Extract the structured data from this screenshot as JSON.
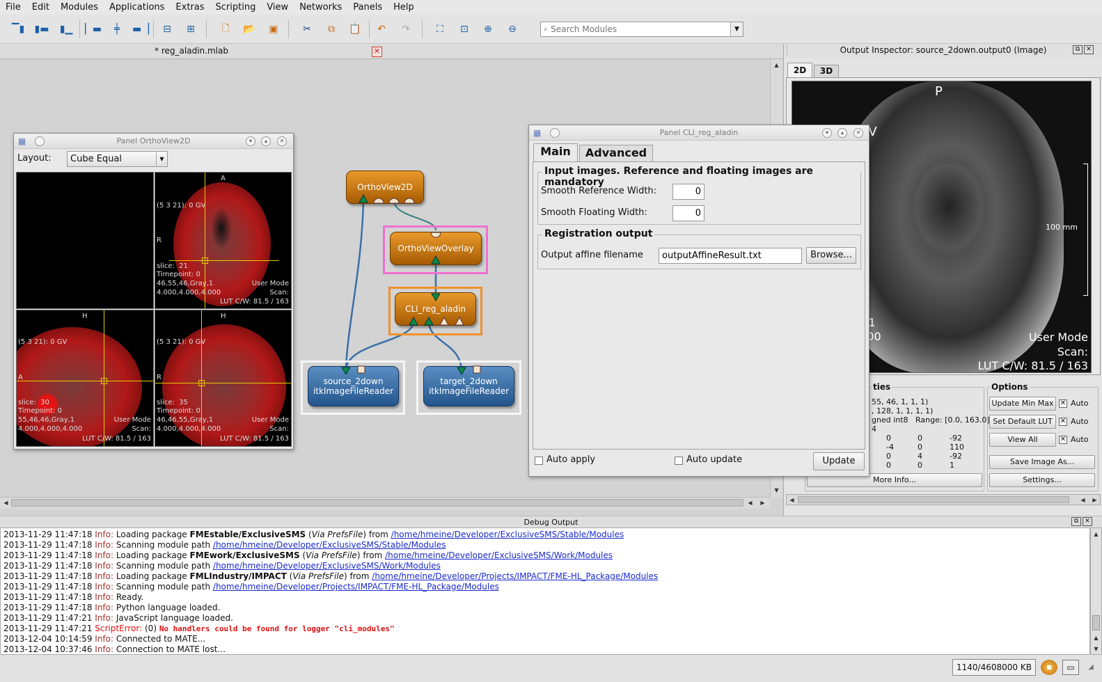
{
  "menu": [
    "File",
    "Edit",
    "Modules",
    "Applications",
    "Extras",
    "Scripting",
    "View",
    "Networks",
    "Panels",
    "Help"
  ],
  "search": {
    "placeholder": "Search Modules"
  },
  "network_tab": {
    "title": "* reg_aladin.mlab"
  },
  "modules": {
    "orthoview2d": "OrthoView2D",
    "overlay": "OrthoViewOverlay",
    "cli": "CLI_reg_aladin",
    "source_line1": "source_2down",
    "source_line2": "itkImageFileReader",
    "target_line1": "target_2down",
    "target_line2": "itkImageFileReader"
  },
  "ortho_panel": {
    "title": "Panel OrthoView2D",
    "layout_label": "Layout:",
    "layout_value": "Cube Equal",
    "vp1": {
      "top": "A",
      "left": "R",
      "gv": "(5 3 21): 0 GV",
      "slice": "slice:  21",
      "timepoint": "Timepoint: 0",
      "coords": "46,55,46,Gray,1",
      "voxel": "4.000,4.000,4.000",
      "mode": "User Mode",
      "scan": "Scan:",
      "lut": "LUT C/W: 81.5 / 163"
    },
    "vp2": {
      "top": "H",
      "left": "A",
      "gv": "(5 3 21): 0 GV",
      "slice": "slice:  30",
      "timepoint": "Timepoint: 0",
      "coords": "55,46,46,Gray,1",
      "voxel": "4.000,4.000,4.000",
      "mode": "User Mode",
      "scan": "Scan:",
      "lut": "LUT C/W: 81.5 / 163"
    },
    "vp3": {
      "top": "H",
      "left": "R",
      "gv": "(5 3 21): 0 GV",
      "slice": "slice:  35",
      "timepoint": "Timepoint: 0",
      "coords": "46,46,55,Gray,1",
      "voxel": "4.000,4.000,4.000",
      "mode": "User Mode",
      "scan": "Scan:",
      "lut": "LUT C/W: 81.5 / 163"
    }
  },
  "cli_panel": {
    "title": "Panel CLI_reg_aladin",
    "tabs": [
      "Main",
      "Advanced"
    ],
    "group1": "Input images. Reference and floating images are mandatory",
    "smooth_ref_label": "Smooth Reference Width:",
    "smooth_ref_value": "0",
    "smooth_flo_label": "Smooth Floating Width:",
    "smooth_flo_value": "0",
    "group2": "Registration output",
    "affine_label": "Output affine filename",
    "affine_value": "outputAffineResult.txt",
    "browse": "Browse...",
    "auto_apply": "Auto apply",
    "auto_update": "Auto update",
    "update": "Update"
  },
  "inspector": {
    "title": "Output Inspector: source_2down.output0 (Image)",
    "tabs": [
      "2D",
      "3D"
    ],
    "orient_top": "P",
    "orient_left_frag": "SV",
    "scale": "100 mm",
    "frag1": "y,1",
    "frag2": ".000",
    "mode": "User Mode",
    "scan": "Scan:",
    "lut": "LUT C/W: 81.5 / 163",
    "props_title": "ties",
    "props": [
      "55, 46, 1, 1, 1)",
      ", 128, 1, 1, 1, 1)",
      "gned int8   Range: [0.0, 163.0]",
      "4"
    ],
    "matrix": [
      [
        "0",
        "0",
        "-92"
      ],
      [
        "-4",
        "0",
        "110"
      ],
      [
        "0",
        "4",
        "-92"
      ],
      [
        "0",
        "0",
        "1"
      ]
    ],
    "more_info": "More Info...",
    "options_title": "Options",
    "update_minmax": "Update Min Max",
    "set_default_lut": "Set Default LUT",
    "view_all": "View All",
    "auto": "Auto",
    "save_image": "Save Image As...",
    "settings": "Settings..."
  },
  "debug": {
    "title": "Debug Output",
    "logs": [
      {
        "ts": "2013-11-29 11:47:18",
        "kind": "Info:",
        "pre": "Loading package ",
        "bold": "FMEstable/ExclusiveSMS",
        "ital": "Via PrefsFile",
        "mid": ") from ",
        "link": "/home/hmeine/Developer/ExclusiveSMS/Stable/Modules"
      },
      {
        "ts": "2013-11-29 11:47:18",
        "kind": "Info:",
        "pre": "Scanning module path ",
        "link": "/home/hmeine/Developer/ExclusiveSMS/Stable/Modules"
      },
      {
        "ts": "2013-11-29 11:47:18",
        "kind": "Info:",
        "pre": "Loading package ",
        "bold": "FMEwork/ExclusiveSMS",
        "ital": "Via PrefsFile",
        "mid": ") from ",
        "link": "/home/hmeine/Developer/ExclusiveSMS/Work/Modules"
      },
      {
        "ts": "2013-11-29 11:47:18",
        "kind": "Info:",
        "pre": "Scanning module path ",
        "link": "/home/hmeine/Developer/ExclusiveSMS/Work/Modules"
      },
      {
        "ts": "2013-11-29 11:47:18",
        "kind": "Info:",
        "pre": "Loading package ",
        "bold": "FMLIndustry/IMPACT",
        "ital": "Via PrefsFile",
        "mid": ") from ",
        "link": "/home/hmeine/Developer/Projects/IMPACT/FME-HL_Package/Modules"
      },
      {
        "ts": "2013-11-29 11:47:18",
        "kind": "Info:",
        "pre": "Scanning module path ",
        "link": "/home/hmeine/Developer/Projects/IMPACT/FME-HL_Package/Modules"
      },
      {
        "ts": "2013-11-29 11:47:18",
        "kind": "Info:",
        "pre": "Ready."
      },
      {
        "ts": "2013-11-29 11:47:18",
        "kind": "Info:",
        "pre": "Python language loaded."
      },
      {
        "ts": "2013-11-29 11:47:21",
        "kind": "Info:",
        "pre": "JavaScript language loaded."
      },
      {
        "ts": "2013-11-29 11:47:21",
        "kind": "ScriptError:",
        "pre": "(0) ",
        "mono": "No handlers could be found for logger \"cli_modules\""
      },
      {
        "ts": "2013-12-04 10:14:59",
        "kind": "Info:",
        "pre": "Connected to MATE..."
      },
      {
        "ts": "2013-12-04 10:37:46",
        "kind": "Info:",
        "pre": "Connection to MATE lost..."
      }
    ]
  },
  "status": {
    "memory": "1140/4608000 KB"
  }
}
